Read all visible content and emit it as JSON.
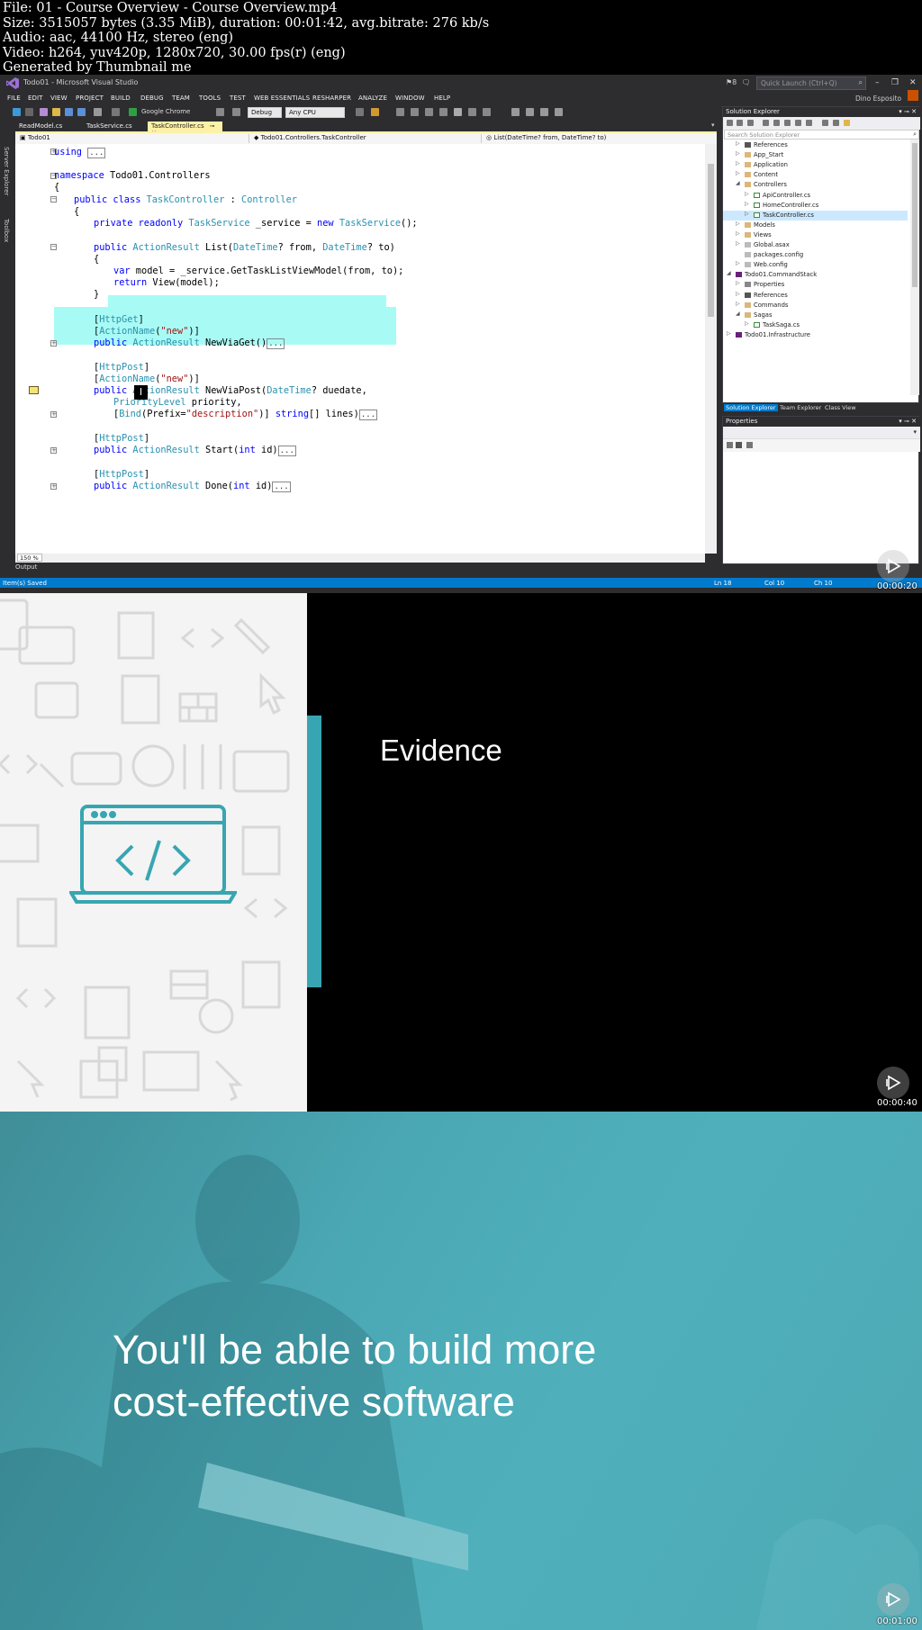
{
  "info": {
    "line1": "File: 01 - Course Overview - Course Overview.mp4",
    "line2": "Size: 3515057 bytes (3.35 MiB), duration: 00:01:42, avg.bitrate: 276 kb/s",
    "line3": "Audio: aac, 44100 Hz, stereo (eng)",
    "line4": "Video: h264, yuv420p, 1280x720, 30.00 fps(r) (eng)",
    "line5": "Generated by Thumbnail me"
  },
  "vs": {
    "title": "Todo01 - Microsoft Visual Studio",
    "filter_count": "8",
    "quick_launch_placeholder": "Quick Launch (Ctrl+Q)",
    "user": "Dino Esposito",
    "menu": [
      "FILE",
      "EDIT",
      "VIEW",
      "PROJECT",
      "BUILD",
      "DEBUG",
      "TEAM",
      "TOOLS",
      "TEST",
      "WEB ESSENTIALS",
      "RESHARPER",
      "ANALYZE",
      "WINDOW",
      "HELP"
    ],
    "toolbar": {
      "browser": "Google Chrome",
      "config": "Debug",
      "platform": "Any CPU"
    },
    "left_tabs": [
      "Server Explorer",
      "Toolbox"
    ],
    "doc_tabs": [
      "ReadModel.cs",
      "TaskService.cs",
      "TaskController.cs"
    ],
    "nav": {
      "project": "Todo01",
      "class": "Todo01.Controllers.TaskController",
      "member": "List(DateTime? from, DateTime? to)"
    },
    "zoom": "150 %",
    "output_tab": "Output",
    "status": {
      "message": "Item(s) Saved",
      "ln": "Ln 18",
      "col": "Col 10",
      "ch": "Ch 10"
    },
    "timestamp": "00:00:20",
    "code": {
      "using": "using",
      "ns_kw": "namespace",
      "ns_name": " Todo01.Controllers",
      "brace_open": "{",
      "class_kw": "public class",
      "class_name": "TaskController",
      "class_sep": " : ",
      "class_base": "Controller",
      "inner_open": "{",
      "field_kw": "private readonly",
      "field_type": "TaskService",
      "field_mid": " _service = ",
      "field_new": "new",
      "field_ctor": "TaskService",
      "field_end": "();",
      "list_pub": "public",
      "list_type": "ActionResult",
      "list_name": " List(",
      "list_dt1": "DateTime",
      "list_p1": "? from, ",
      "list_dt2": "DateTime",
      "list_p2": "? to)",
      "m_open": "{",
      "var_kw": "var",
      "var_rest": " model = _service.GetTaskListViewModel(from, to);",
      "ret_kw": "return",
      "ret_rest": " View(model);",
      "m_close": "}",
      "httpget": "HttpGet",
      "actionname": "ActionName",
      "new_str": "\"new\"",
      "pub": "public",
      "ar": "ActionResult",
      "get_name": " NewViaGet()",
      "httppost": "HttpPost",
      "post_name": " NewViaPost(",
      "post_dt": "DateTime",
      "post_p1": "? duedate,",
      "prio_type": "PriorityLevel",
      "prio_rest": " priority,",
      "bind": "Bind",
      "prefix": "(Prefix=",
      "desc_str": "\"description\"",
      "bind_close": ")] ",
      "string_kw": "string",
      "lines_rest": "[] lines)",
      "start_name": " Start(",
      "int_kw": "int",
      "id_rest": " id)",
      "done_name": " Done(",
      "ellipsis": "...",
      "lbr": "[",
      "rbr": "]",
      "paren_open": "(",
      "paren_close": ")]"
    },
    "solution_explorer": {
      "title": "Solution Explorer",
      "search_placeholder": "Search Solution Explorer",
      "items": [
        {
          "label": "References",
          "icon": "ref"
        },
        {
          "label": "App_Start",
          "icon": "folder"
        },
        {
          "label": "Application",
          "icon": "folder"
        },
        {
          "label": "Content",
          "icon": "folder"
        },
        {
          "label": "Controllers",
          "icon": "folder"
        },
        {
          "label": "ApiController.cs",
          "icon": "cs"
        },
        {
          "label": "HomeController.cs",
          "icon": "cs"
        },
        {
          "label": "TaskController.cs",
          "icon": "cs"
        },
        {
          "label": "Models",
          "icon": "folder"
        },
        {
          "label": "Views",
          "icon": "folder"
        },
        {
          "label": "Global.asax",
          "icon": "file"
        },
        {
          "label": "packages.config",
          "icon": "file"
        },
        {
          "label": "Web.config",
          "icon": "file"
        },
        {
          "label": "Todo01.CommandStack",
          "icon": "proj"
        },
        {
          "label": "Properties",
          "icon": "wrench"
        },
        {
          "label": "References",
          "icon": "ref"
        },
        {
          "label": "Commands",
          "icon": "folder"
        },
        {
          "label": "Sagas",
          "icon": "folder"
        },
        {
          "label": "TaskSaga.cs",
          "icon": "cs"
        },
        {
          "label": "Todo01.Infrastructure",
          "icon": "proj"
        }
      ],
      "bottom_tabs": [
        "Solution Explorer",
        "Team Explorer",
        "Class View"
      ]
    },
    "properties_title": "Properties"
  },
  "slide2": {
    "title": "Evidence",
    "timestamp": "00:00:40"
  },
  "slide3": {
    "line1": "You'll be able to build more",
    "line2": "cost-effective software",
    "timestamp": "00:01:00"
  },
  "colors": {
    "vs_bg": "#2d2d30",
    "vs_blue": "#007acc",
    "selection": "#a8fbf5",
    "teal": "#38a5b2",
    "tab_active": "#fdf1a7"
  }
}
